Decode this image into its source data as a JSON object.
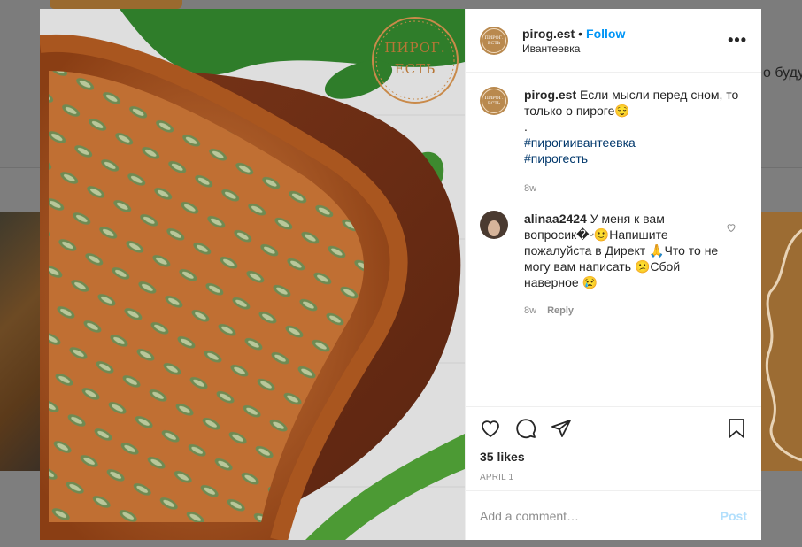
{
  "background": {
    "right_text": "о буду"
  },
  "post": {
    "image_logo_lines": [
      "ПИРОГ.",
      "ЕСТЬ"
    ],
    "avatar_lines": [
      "ПИРОГ.",
      "ЕСТЬ"
    ],
    "header": {
      "username": "pirog.est",
      "dot": "•",
      "follow_label": "Follow",
      "location": "Ивантеевка",
      "more_label": "•••"
    },
    "caption": {
      "username": "pirog.est",
      "text": "Если мысли перед сном, то только о пироге😌",
      "dot_line": ".",
      "hashtags": [
        "#пирогиивантеевка",
        "#пирогесть"
      ],
      "age": "8w"
    },
    "comments": [
      {
        "username": "alinaa2424",
        "text": "У меня к вам вопросик�ᵕ🙂Напишите пожалуйста в Директ 🙏Что то не могу вам написать 😕Сбой наверное 😢",
        "age": "8w",
        "reply_label": "Reply"
      }
    ],
    "likes": "35 likes",
    "date": "APRIL 1",
    "add_comment_placeholder": "Add a comment…",
    "post_label": "Post"
  },
  "colors": {
    "accent": "#0095f6",
    "hashtag": "#00376b",
    "muted": "#8e8e8e",
    "brand": "#b9894e"
  }
}
